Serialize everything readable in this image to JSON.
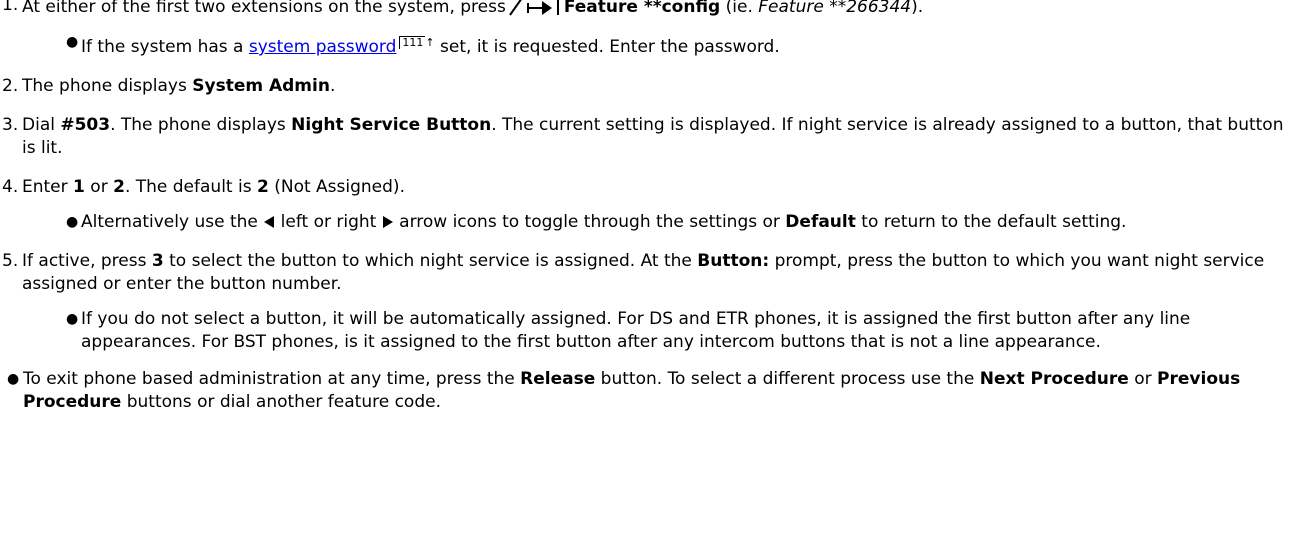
{
  "steps": [
    {
      "number": "1.",
      "pre": "At either of the first two extensions on the system, press",
      "bold": "Feature **config",
      "mid": " (ie. ",
      "italic": "Feature **266344",
      "post": ").",
      "icon": "feature-button-icon",
      "sub": {
        "pre": "If the system has a ",
        "link": "system password",
        "pageref": "111",
        "post": " set, it is requested. Enter the password."
      }
    },
    {
      "number": "2.",
      "pre": "The phone displays ",
      "bold": "System Admin",
      "post": "."
    },
    {
      "number": "3.",
      "pre": "Dial ",
      "bold1": "#503",
      "mid": ". The phone displays ",
      "bold2": "Night Service Button",
      "post": ". The current setting is displayed. If night service is already assigned to a button, that button is lit."
    },
    {
      "number": "4.",
      "pre": "Enter ",
      "bold1": "1",
      "mid1": " or ",
      "bold2": "2",
      "mid2": ". The default is ",
      "bold3": "2",
      "post": " (Not Assigned).",
      "sub": {
        "pre": "Alternatively use the ",
        "left_icon": "left-arrow-icon",
        "mid1": " left or right ",
        "right_icon": "right-arrow-icon",
        "mid2": " arrow icons to toggle through the settings or ",
        "bold": "Default",
        "post": " to return to the default setting."
      }
    },
    {
      "number": "5.",
      "pre": "If active, press ",
      "bold1": "3",
      "mid": " to select the button to which night service is assigned. At the ",
      "bold2": "Button:",
      "post": " prompt, press the button to which you want night service assigned or enter the button number.",
      "sub": {
        "text": "If you do not select a button, it will be automatically assigned. For DS and ETR phones, it is assigned the first button after any line appearances. For BST phones, is it assigned to the first button after any intercom buttons that is not a line appearance."
      }
    }
  ],
  "tail": {
    "pre": "To exit phone based administration at any time, press the ",
    "bold1": "Release",
    "mid1": " button. To select a different process use the ",
    "bold2": "Next Procedure",
    "mid2": " or ",
    "bold3": "Previous Procedure",
    "post": " buttons or dial another feature code."
  }
}
